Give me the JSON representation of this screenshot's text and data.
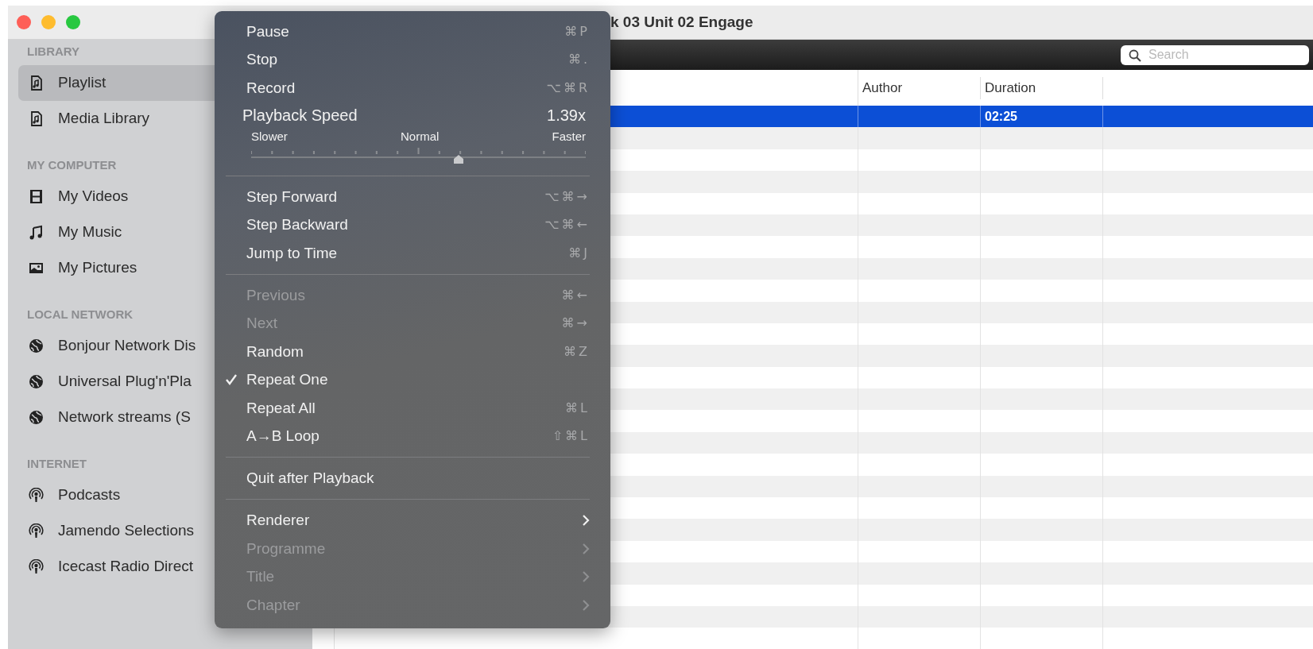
{
  "window": {
    "title": "k 03 Unit 02 Engage"
  },
  "sidebar": {
    "sections": [
      {
        "header": "LIBRARY",
        "items": [
          {
            "label": "Playlist",
            "kind": "playlist",
            "selected": true
          },
          {
            "label": "Media Library",
            "kind": "playlist",
            "selected": false
          }
        ]
      },
      {
        "header": "MY COMPUTER",
        "items": [
          {
            "label": "My Videos",
            "kind": "video",
            "selected": false
          },
          {
            "label": "My Music",
            "kind": "music",
            "selected": false
          },
          {
            "label": "My Pictures",
            "kind": "picture",
            "selected": false
          }
        ]
      },
      {
        "header": "LOCAL NETWORK",
        "items": [
          {
            "label": "Bonjour Network Dis",
            "kind": "network",
            "selected": false
          },
          {
            "label": "Universal Plug'n'Pla",
            "kind": "network",
            "selected": false
          },
          {
            "label": "Network streams (S",
            "kind": "network",
            "selected": false
          }
        ]
      },
      {
        "header": "INTERNET",
        "items": [
          {
            "label": "Podcasts",
            "kind": "podcast",
            "selected": false
          },
          {
            "label": "Jamendo Selections",
            "kind": "podcast",
            "selected": false
          },
          {
            "label": "Icecast Radio Direct",
            "kind": "podcast",
            "selected": false
          }
        ]
      }
    ]
  },
  "toolbar": {
    "search": {
      "placeholder": "Search"
    }
  },
  "table": {
    "columns": [
      {
        "label": "Author"
      },
      {
        "label": "Duration"
      }
    ],
    "rows": [
      {
        "duration": "02:25",
        "selected": true
      }
    ]
  },
  "menu": {
    "items": [
      {
        "kind": "item",
        "label": "Pause",
        "shortcut": "⌘P",
        "disabled": false,
        "checked": false
      },
      {
        "kind": "item",
        "label": "Stop",
        "shortcut": "⌘.",
        "disabled": false,
        "checked": false
      },
      {
        "kind": "item",
        "label": "Record",
        "shortcut": "⌥⌘R",
        "disabled": false,
        "checked": false
      },
      {
        "kind": "slider",
        "label": "Playback Speed",
        "reading": "1.39x",
        "scale_labels": [
          "Slower",
          "Normal",
          "Faster"
        ],
        "level": 0.62
      },
      {
        "kind": "separator"
      },
      {
        "kind": "item",
        "label": "Step Forward",
        "shortcut": "⌥⌘→",
        "disabled": false,
        "checked": false
      },
      {
        "kind": "item",
        "label": "Step Backward",
        "shortcut": "⌥⌘←",
        "disabled": false,
        "checked": false
      },
      {
        "kind": "item",
        "label": "Jump to Time",
        "shortcut": "⌘J",
        "disabled": false,
        "checked": false
      },
      {
        "kind": "separator"
      },
      {
        "kind": "item",
        "label": "Previous",
        "shortcut": "⌘←",
        "disabled": true,
        "checked": false
      },
      {
        "kind": "item",
        "label": "Next",
        "shortcut": "⌘→",
        "disabled": true,
        "checked": false
      },
      {
        "kind": "item",
        "label": "Random",
        "shortcut": "⌘Z",
        "disabled": false,
        "checked": false
      },
      {
        "kind": "item",
        "label": "Repeat One",
        "disabled": false,
        "checked": true
      },
      {
        "kind": "item",
        "label": "Repeat All",
        "shortcut": "⌘L",
        "disabled": false,
        "checked": false
      },
      {
        "kind": "item",
        "label": "A→B Loop",
        "shortcut": "⇧⌘L",
        "disabled": false,
        "checked": false
      },
      {
        "kind": "separator"
      },
      {
        "kind": "item",
        "label": "Quit after Playback",
        "disabled": false,
        "checked": false
      },
      {
        "kind": "separator"
      },
      {
        "kind": "submenu",
        "label": "Renderer",
        "disabled": false,
        "checked": false
      },
      {
        "kind": "submenu",
        "label": "Programme",
        "disabled": true,
        "checked": false
      },
      {
        "kind": "submenu",
        "label": "Title",
        "disabled": true,
        "checked": false
      },
      {
        "kind": "submenu",
        "label": "Chapter",
        "disabled": true,
        "checked": false
      }
    ]
  }
}
